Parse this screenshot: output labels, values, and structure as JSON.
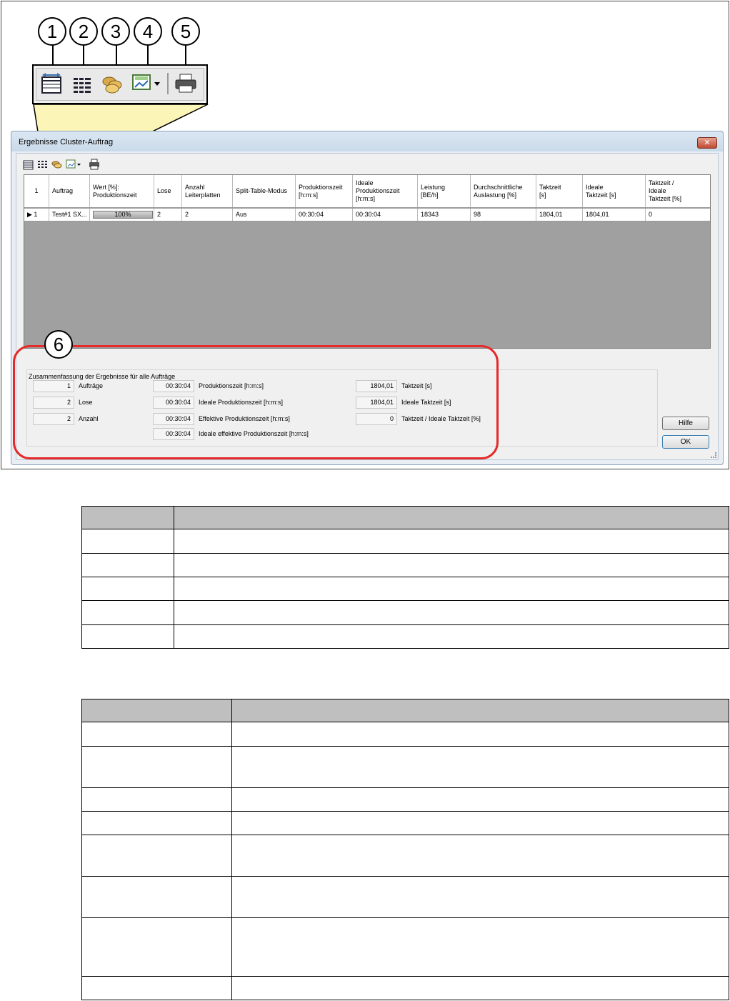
{
  "callouts": [
    "1",
    "2",
    "3",
    "4",
    "5",
    "6"
  ],
  "dialog": {
    "title": "Ergebnisse Cluster-Auftrag",
    "close_symbol": "✕"
  },
  "toolbar": {
    "icons": [
      "column-width-icon",
      "list-view-icon",
      "cluster-orders-icon",
      "chart-dropdown-icon",
      "print-icon"
    ]
  },
  "grid": {
    "corner_label": "1",
    "columns": [
      "Auftrag",
      "Wert [%]:\nProduktionszeit",
      "Lose",
      "Anzahl\nLeiterplatten",
      "Split-Table-Modus",
      "Produktionszeit\n[h:m:s]",
      "Ideale\nProduktionszeit\n[h:m:s]",
      "Leistung\n[BE/h]",
      "Durchschnittliche\nAuslastung [%]",
      "Taktzeit\n[s]",
      "Ideale\nTaktzeit [s]",
      "Taktzeit /\nIdeale\nTaktzeit [%]"
    ],
    "row": {
      "indicator": "▶ 1",
      "values": [
        "Test#1 SX...",
        "100%",
        "2",
        "2",
        "Aus",
        "00:30:04",
        "00:30:04",
        "18343",
        "98",
        "1804,01",
        "1804,01",
        "0"
      ],
      "progress": 1.0
    }
  },
  "summary": {
    "title": "Zusammenfassung der Ergebnisse für alle Aufträge",
    "col1": [
      {
        "value": "1",
        "label": "Aufträge"
      },
      {
        "value": "2",
        "label": "Lose"
      },
      {
        "value": "2",
        "label": "Anzahl"
      }
    ],
    "col2": [
      {
        "value": "00:30:04",
        "label": "Produktionszeit [h:m:s]"
      },
      {
        "value": "00:30:04",
        "label": "Ideale Produktionszeit [h:m:s]"
      },
      {
        "value": "00:30:04",
        "label": "Effektive Produktionszeit [h:m:s]"
      },
      {
        "value": "00:30:04",
        "label": "Ideale effektive Produktionszeit [h:m:s]"
      }
    ],
    "col3": [
      {
        "value": "1804,01",
        "label": "Taktzeit [s]"
      },
      {
        "value": "1804,01",
        "label": "Ideale Taktzeit [s]"
      },
      {
        "value": "0",
        "label": "Taktzeit / Ideale Taktzeit [%]"
      }
    ]
  },
  "buttons": {
    "help": "Hilfe",
    "ok": "OK"
  },
  "colors": {
    "highlight": "#e52a2a",
    "table_header": "#bfbfbf"
  }
}
